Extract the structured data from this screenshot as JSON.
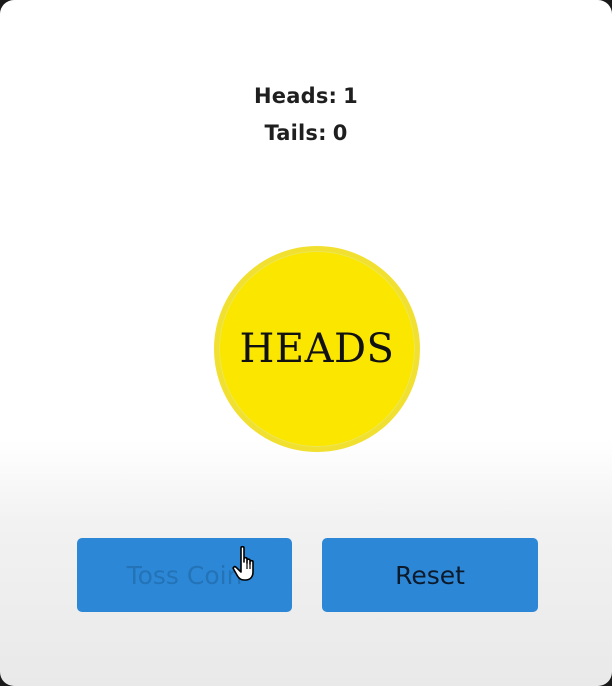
{
  "scoreboard": {
    "heads_label": "Heads:",
    "heads_count": "1",
    "tails_label": "Tails:",
    "tails_count": "0"
  },
  "coin": {
    "face": "HEADS",
    "color": "#fbe600"
  },
  "buttons": {
    "toss_label": "Toss Coin",
    "reset_label": "Reset",
    "color": "#2c88d6"
  },
  "cursor": {
    "icon": "hand-pointer-icon"
  }
}
